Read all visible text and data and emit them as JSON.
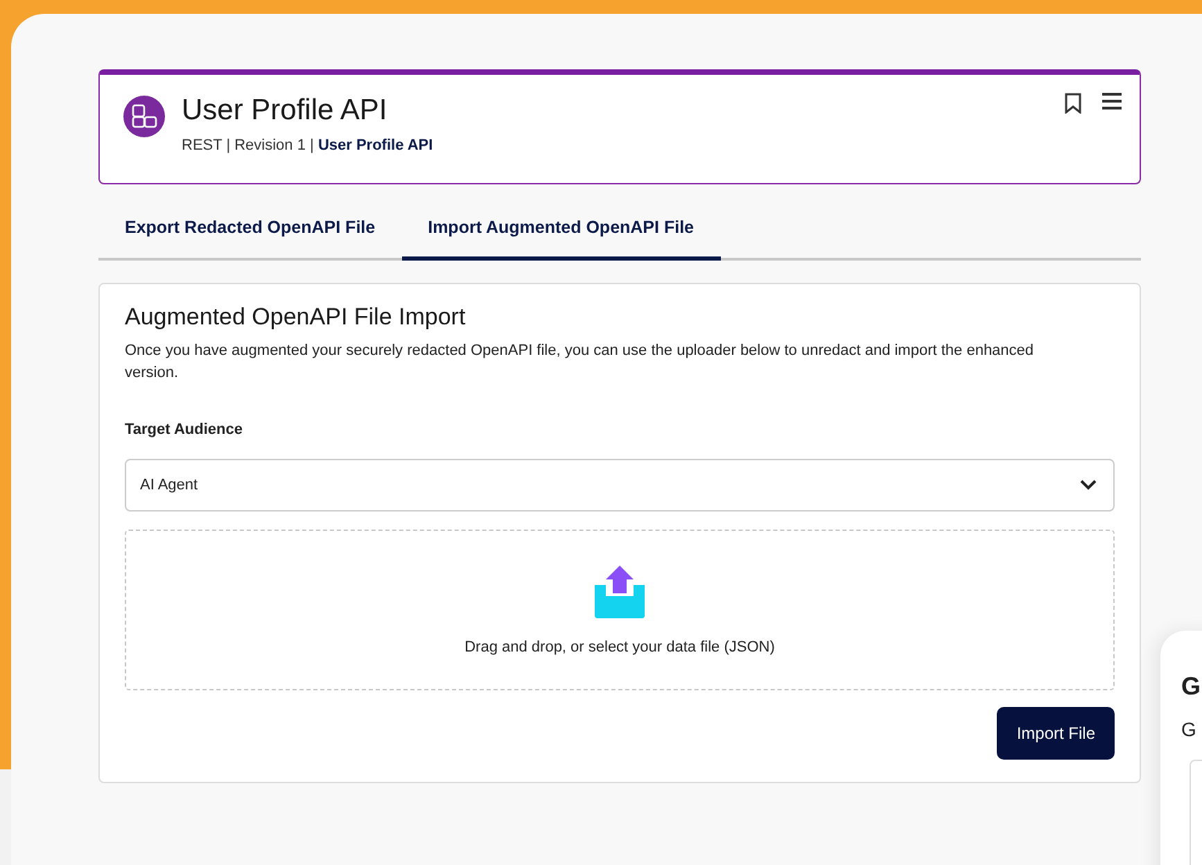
{
  "header": {
    "title": "User Profile API",
    "meta": "REST | Revision 1 | ",
    "meta_link": "User Profile API"
  },
  "tabs": [
    {
      "label": "Export Redacted OpenAPI File",
      "selected": false
    },
    {
      "label": "Import Augmented OpenAPI File",
      "selected": true
    }
  ],
  "section": {
    "title": "Augmented OpenAPI File Import",
    "description": "Once you have augmented your securely redacted OpenAPI file, you can use the uploader below to unredact and import the enhanced version.",
    "audience_label": "Target Audience",
    "audience_value": "AI Agent",
    "dropzone_text": "Drag and drop, or select your data file (JSON)",
    "button": "Import File"
  },
  "side_card": {
    "title": "G",
    "subtitle": "G"
  }
}
